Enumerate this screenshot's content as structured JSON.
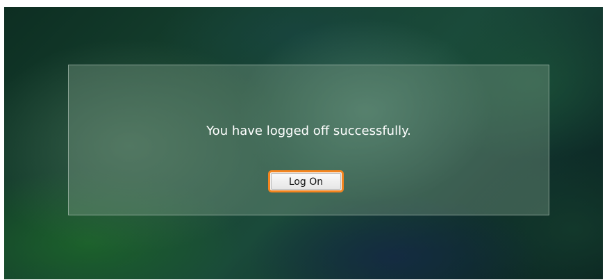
{
  "logoff": {
    "message": "You have logged off successfully.",
    "button_label": "Log On"
  },
  "colors": {
    "button_focus_border": "#f5851f",
    "background_dark_green": "#15402e",
    "message_text": "#ffffff"
  }
}
